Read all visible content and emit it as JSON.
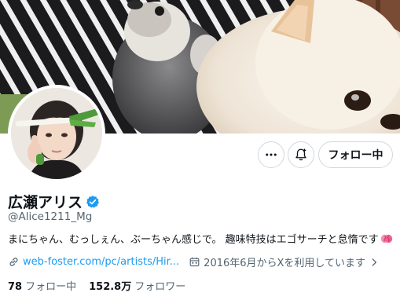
{
  "profile": {
    "display_name": "広瀬アリス",
    "handle": "@Alice1211_Mg",
    "bio": "まにちゃん、むっしぇん、ぶーちゃん感じで。 趣味特技はエゴサーチと怠惰です",
    "website": "web-foster.com/pc/artists/Hir...",
    "joined": "2016年6月からXを利用しています"
  },
  "actions": {
    "follow_label": "フォロー中"
  },
  "stats": {
    "following_count": "78",
    "following_label": "フォロー中",
    "followers_count": "152.8万",
    "followers_label": "フォロワー"
  },
  "icons": {
    "more": "more-icon",
    "notify": "notification-add-icon",
    "verified": "verified-badge-icon",
    "link": "link-icon",
    "calendar": "calendar-icon",
    "brain_emoji": "brain-emoji-icon"
  },
  "colors": {
    "accent": "#1d9bf0",
    "text_primary": "#0f1419",
    "text_secondary": "#536471",
    "border": "#cfd9de"
  }
}
